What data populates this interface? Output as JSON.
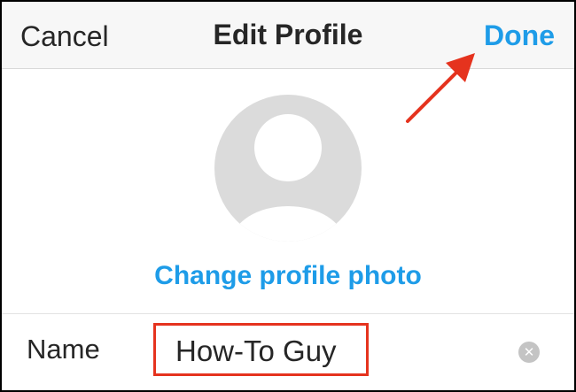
{
  "navbar": {
    "cancel_label": "Cancel",
    "title": "Edit Profile",
    "done_label": "Done"
  },
  "profile": {
    "change_photo_label": "Change profile photo"
  },
  "form": {
    "name_label": "Name",
    "name_value": "How-To Guy"
  },
  "icons": {
    "avatar": "default-avatar-icon",
    "clear": "clear-x-icon",
    "annotation": "red-arrow-icon"
  },
  "colors": {
    "accent": "#1e9ce8",
    "text": "#262626",
    "highlight": "#e5331e",
    "avatar_bg": "#dbdbdb"
  }
}
